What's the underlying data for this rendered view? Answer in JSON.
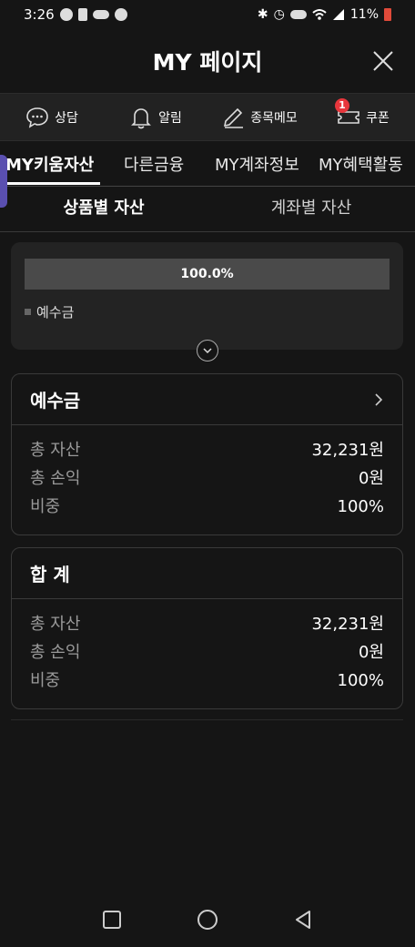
{
  "status_bar": {
    "time": "3:26",
    "battery": "11%",
    "icons": [
      "chat-icon",
      "alert-icon",
      "glasses-icon",
      "kiwoom-icon",
      "bluetooth-icon",
      "alarm-icon",
      "hd-icon",
      "wifi-icon",
      "signal-icon",
      "battery-icon"
    ]
  },
  "header": {
    "title": "MY 페이지",
    "close_icon": "close-icon"
  },
  "quick_bar": {
    "items": [
      {
        "label": "상담",
        "icon": "chat-bubble-icon"
      },
      {
        "label": "알림",
        "icon": "bell-icon"
      },
      {
        "label": "종목메모",
        "icon": "pencil-icon"
      },
      {
        "label": "쿠폰",
        "icon": "coupon-icon",
        "badge": "1"
      }
    ],
    "badge_color": "#e8363c"
  },
  "main_tabs": {
    "items": [
      "MY키움자산",
      "다른금융",
      "MY계좌정보",
      "MY혜택활동"
    ],
    "active_index": 0
  },
  "sub_tabs": {
    "items": [
      "상품별 자산",
      "계좌별 자산"
    ],
    "active_index": 0
  },
  "summary": {
    "bar_percent_label": "100.0%",
    "bar_fraction": 1.0,
    "legend_label": "예수금"
  },
  "deposit_card": {
    "title": "예수금",
    "rows": [
      {
        "label": "총 자산",
        "value": "32,231원"
      },
      {
        "label": "총 손익",
        "value": "0원"
      },
      {
        "label": "비중",
        "value": "100%"
      }
    ]
  },
  "total_card": {
    "title": "합 계",
    "rows": [
      {
        "label": "총 자산",
        "value": "32,231원"
      },
      {
        "label": "총 손익",
        "value": "0원"
      },
      {
        "label": "비중",
        "value": "100%"
      }
    ]
  },
  "colors": {
    "background": "#151515",
    "panel": "#232323",
    "accent_purple": "#5a4fb0",
    "muted_text": "#9a9a9a"
  },
  "nav": {
    "icons": [
      "recent-apps-icon",
      "home-icon",
      "back-icon"
    ]
  }
}
